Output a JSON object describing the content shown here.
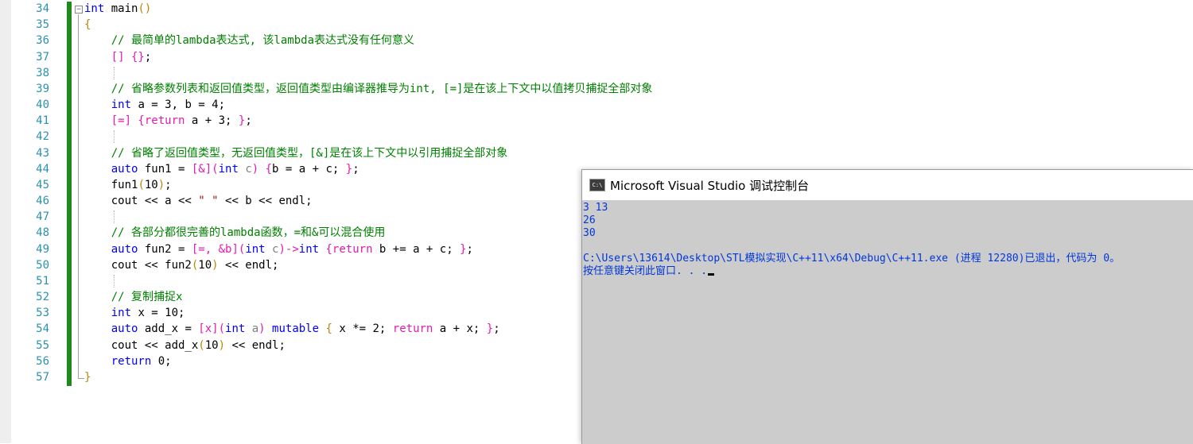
{
  "editor": {
    "line_numbers": [
      "34",
      "35",
      "36",
      "37",
      "38",
      "39",
      "40",
      "41",
      "42",
      "43",
      "44",
      "45",
      "46",
      "47",
      "48",
      "49",
      "50",
      "51",
      "52",
      "53",
      "54",
      "55",
      "56",
      "57"
    ],
    "lines": [
      [
        {
          "t": "int",
          "c": "kw"
        },
        {
          "t": " main",
          "c": ""
        },
        {
          "t": "()",
          "c": "yb"
        }
      ],
      [
        {
          "t": "{",
          "c": "yb"
        }
      ],
      [
        {
          "t": "    // 最简单的lambda表达式, 该lambda表达式没有任何意义",
          "c": "cm"
        }
      ],
      [
        {
          "t": "    ",
          "c": ""
        },
        {
          "t": "[] {}",
          "c": "br"
        },
        {
          "t": ";",
          "c": ""
        }
      ],
      [],
      [
        {
          "t": "    // 省略参数列表和返回值类型，返回值类型由编译器推导为int, [=]是在该上下文中以值拷贝捕捉全部对象",
          "c": "cm"
        }
      ],
      [
        {
          "t": "    ",
          "c": ""
        },
        {
          "t": "int",
          "c": "kw"
        },
        {
          "t": " a = 3, b = 4;",
          "c": ""
        }
      ],
      [
        {
          "t": "    ",
          "c": ""
        },
        {
          "t": "[=] {",
          "c": "br"
        },
        {
          "t": "return",
          "c": "br"
        },
        {
          "t": " a + 3; ",
          "c": ""
        },
        {
          "t": "}",
          "c": "br"
        },
        {
          "t": ";",
          "c": ""
        }
      ],
      [],
      [
        {
          "t": "    // 省略了返回值类型，无返回值类型，[&]是在该上下文中以引用捕捉全部对象",
          "c": "cm"
        }
      ],
      [
        {
          "t": "    ",
          "c": ""
        },
        {
          "t": "auto",
          "c": "kw"
        },
        {
          "t": " fun1 = ",
          "c": ""
        },
        {
          "t": "[&](",
          "c": "br"
        },
        {
          "t": "int",
          "c": "kw"
        },
        {
          "t": " c",
          "c": "pr"
        },
        {
          "t": ") {",
          "c": "br"
        },
        {
          "t": "b = a + c; ",
          "c": ""
        },
        {
          "t": "}",
          "c": "br"
        },
        {
          "t": ";",
          "c": ""
        }
      ],
      [
        {
          "t": "    fun1",
          "c": ""
        },
        {
          "t": "(",
          "c": "yb"
        },
        {
          "t": "10",
          "c": ""
        },
        {
          "t": ")",
          "c": "yb"
        },
        {
          "t": ";",
          "c": ""
        }
      ],
      [
        {
          "t": "    cout << a << ",
          "c": ""
        },
        {
          "t": "\" \"",
          "c": "st"
        },
        {
          "t": " << b << endl;",
          "c": ""
        }
      ],
      [],
      [
        {
          "t": "    // 各部分都很完善的lambda函数，=和&可以混合使用",
          "c": "cm"
        }
      ],
      [
        {
          "t": "    ",
          "c": ""
        },
        {
          "t": "auto",
          "c": "kw"
        },
        {
          "t": " fun2 = ",
          "c": ""
        },
        {
          "t": "[=, &b](",
          "c": "br"
        },
        {
          "t": "int",
          "c": "kw"
        },
        {
          "t": " c",
          "c": "pr"
        },
        {
          "t": ")->",
          "c": "br"
        },
        {
          "t": "int",
          "c": "kw"
        },
        {
          "t": " {",
          "c": "br"
        },
        {
          "t": "return",
          "c": "br"
        },
        {
          "t": " b += a + c; ",
          "c": ""
        },
        {
          "t": "}",
          "c": "br"
        },
        {
          "t": ";",
          "c": ""
        }
      ],
      [
        {
          "t": "    cout << fun2",
          "c": ""
        },
        {
          "t": "(",
          "c": "yb"
        },
        {
          "t": "10",
          "c": ""
        },
        {
          "t": ")",
          "c": "yb"
        },
        {
          "t": " << endl;",
          "c": ""
        }
      ],
      [],
      [
        {
          "t": "    // 复制捕捉x",
          "c": "cm"
        }
      ],
      [
        {
          "t": "    ",
          "c": ""
        },
        {
          "t": "int",
          "c": "kw"
        },
        {
          "t": " x = 10;",
          "c": ""
        }
      ],
      [
        {
          "t": "    ",
          "c": ""
        },
        {
          "t": "auto",
          "c": "kw"
        },
        {
          "t": " add_x = ",
          "c": ""
        },
        {
          "t": "[x](",
          "c": "br"
        },
        {
          "t": "int",
          "c": "kw"
        },
        {
          "t": " a",
          "c": "pr"
        },
        {
          "t": ") ",
          "c": "br"
        },
        {
          "t": "mutable",
          "c": "kw"
        },
        {
          "t": " { ",
          "c": "yb"
        },
        {
          "t": "x *= 2; ",
          "c": ""
        },
        {
          "t": "return",
          "c": "br"
        },
        {
          "t": " a + x; ",
          "c": ""
        },
        {
          "t": "}",
          "c": "br"
        },
        {
          "t": ";",
          "c": ""
        }
      ],
      [
        {
          "t": "    cout << add_x",
          "c": ""
        },
        {
          "t": "(",
          "c": "yb"
        },
        {
          "t": "10",
          "c": ""
        },
        {
          "t": ")",
          "c": "yb"
        },
        {
          "t": " << endl;",
          "c": ""
        }
      ],
      [
        {
          "t": "    ",
          "c": ""
        },
        {
          "t": "return",
          "c": "kw"
        },
        {
          "t": " 0;",
          "c": ""
        }
      ],
      [
        {
          "t": "}",
          "c": "yb"
        }
      ]
    ]
  },
  "console": {
    "title": "Microsoft Visual Studio 调试控制台",
    "icon_name": "console-app-icon",
    "output_lines": [
      "3 13",
      "26",
      "30",
      "",
      "C:\\Users\\13614\\Desktop\\STL模拟实现\\C++11\\x64\\Debug\\C++11.exe (进程 12280)已退出，代码为 0。",
      "按任意键关闭此窗口. . ."
    ]
  },
  "colors": {
    "keyword": "#0000ff",
    "comment": "#008000",
    "bracket": "#e31bb3",
    "param": "#808080",
    "string": "#a31515",
    "line_number": "#2b91af",
    "change_bar": "#1e8a1e",
    "console_text": "#0037da",
    "console_bg": "#cccccc"
  }
}
